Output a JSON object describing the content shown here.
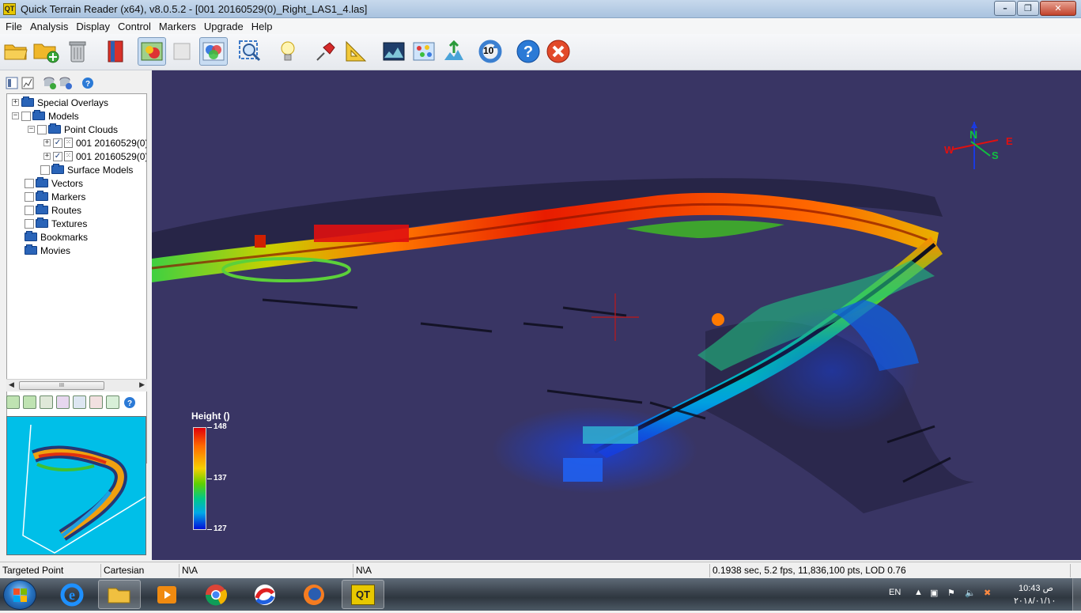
{
  "window": {
    "title": "Quick Terrain Reader (x64), v8.0.5.2  - [001 20160529(0)_Right_LAS1_4.las]",
    "app_icon_text": "QT"
  },
  "menu": [
    "File",
    "Analysis",
    "Display",
    "Control",
    "Markers",
    "Upgrade",
    "Help"
  ],
  "toolbar": {
    "buttons": [
      "open-folder-icon",
      "add-folder-icon",
      "delete-icon",
      "bookmark-icon",
      "display-model-icon",
      "blank-icon",
      "overlay-icon",
      "zoom-fit-icon",
      "lightbulb-icon",
      "pin-icon",
      "ruler-icon",
      "profile-icon",
      "points-icon",
      "flythrough-icon",
      "rotate-icon",
      "help-icon",
      "exit-icon"
    ],
    "rotate_label": "10"
  },
  "tree": {
    "items": [
      {
        "label": "Special Overlays",
        "level": 0,
        "expander": "+",
        "checkbox": false
      },
      {
        "label": "Models",
        "level": 0,
        "expander": "-",
        "checkbox": true,
        "checked": false
      },
      {
        "label": "Point Clouds",
        "level": 1,
        "expander": "-",
        "checkbox": true,
        "checked": false
      },
      {
        "label": "001 20160529(0)",
        "level": 2,
        "expander": "+",
        "checkbox": true,
        "checked": true
      },
      {
        "label": "001 20160529(0)",
        "level": 2,
        "expander": "+",
        "checkbox": true,
        "checked": true
      },
      {
        "label": "Surface Models",
        "level": 1,
        "expander": "",
        "checkbox": true,
        "checked": false
      },
      {
        "label": "Vectors",
        "level": 0,
        "expander": "",
        "checkbox": true,
        "checked": false
      },
      {
        "label": "Markers",
        "level": 0,
        "expander": "",
        "checkbox": true,
        "checked": false
      },
      {
        "label": "Routes",
        "level": 0,
        "expander": "",
        "checkbox": true,
        "checked": false
      },
      {
        "label": "Textures",
        "level": 0,
        "expander": "",
        "checkbox": true,
        "checked": false
      },
      {
        "label": "Bookmarks",
        "level": 0,
        "expander": "",
        "checkbox": false
      },
      {
        "label": "Movies",
        "level": 0,
        "expander": "",
        "checkbox": false
      }
    ],
    "scroll_thumb_label": "III"
  },
  "legend": {
    "title": "Height ()",
    "max": "148",
    "mid": "137",
    "min": "127"
  },
  "compass": {
    "n": "N",
    "s": "S",
    "e": "E",
    "w": "W"
  },
  "status": {
    "mode": "Targeted Point",
    "coords": "Cartesian",
    "value1": "N\\A",
    "value2": "N\\A",
    "perf": "0.1938 sec,   5.2 fps,     11,836,100 pts, LOD 0.76"
  },
  "taskbar": {
    "apps": [
      "internet-explorer-icon",
      "file-explorer-icon",
      "media-player-icon",
      "chrome-icon",
      "paint-icon",
      "firefox-icon",
      "qt-reader-icon"
    ],
    "lang": "EN",
    "time": "ص 10:43",
    "date": "٢٠١٨/٠١/١٠",
    "qt_label": "QT"
  }
}
